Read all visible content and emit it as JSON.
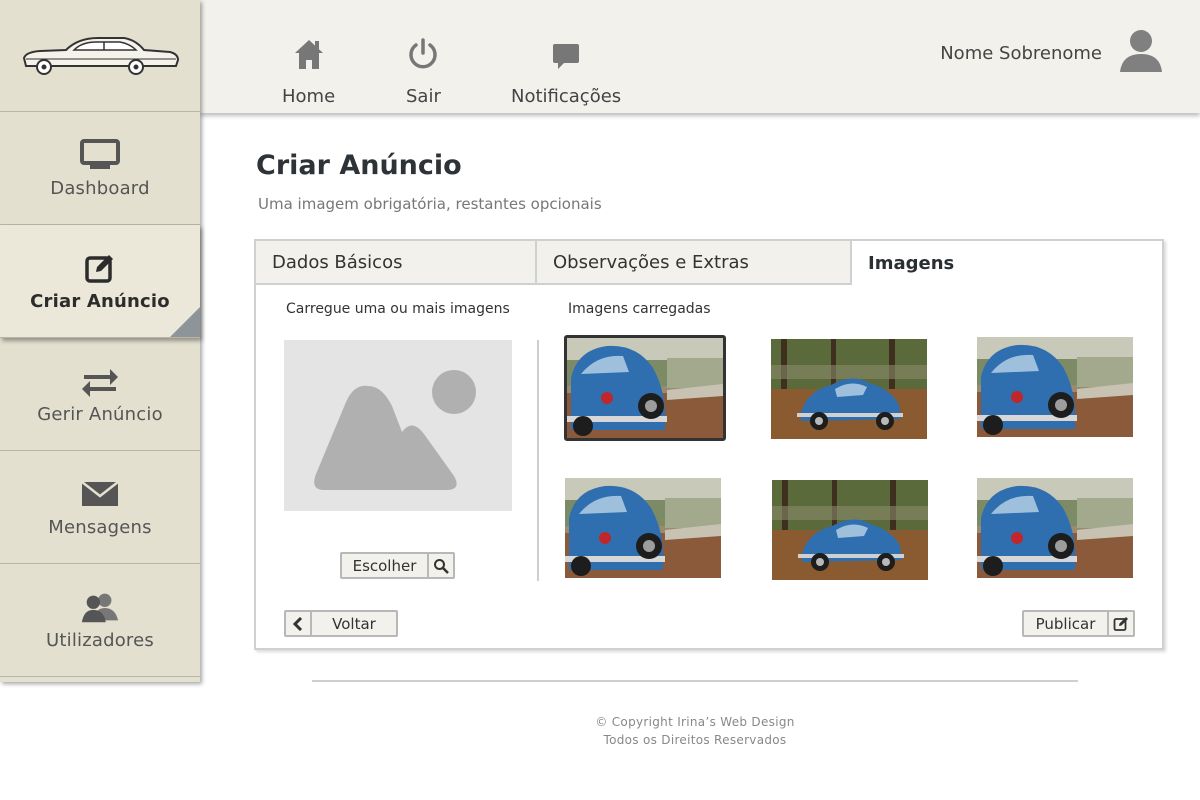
{
  "topbar": {
    "nav": [
      {
        "label": "Home",
        "icon": "home-icon"
      },
      {
        "label": "Sair",
        "icon": "power-icon"
      },
      {
        "label": "Notificações",
        "icon": "chat-icon"
      }
    ],
    "user_name": "Nome Sobrenome"
  },
  "sidebar": {
    "logo_icon": "car-logo-icon",
    "items": [
      {
        "label": "Dashboard",
        "icon": "monitor-icon"
      },
      {
        "label": "Criar Anúncio",
        "icon": "edit-icon",
        "active": true
      },
      {
        "label": "Gerir Anúncio",
        "icon": "exchange-icon"
      },
      {
        "label": "Mensagens",
        "icon": "envelope-icon"
      },
      {
        "label": "Utilizadores",
        "icon": "users-icon"
      }
    ]
  },
  "main": {
    "title": "Criar Anúncio",
    "subtitle": "Uma imagem obrigatória, restantes opcionais",
    "tabs": [
      {
        "label": "Dados Básicos"
      },
      {
        "label": "Observações e Extras"
      },
      {
        "label": "Imagens",
        "active": true
      }
    ],
    "upload_label": "Carregue uma ou mais imagens",
    "uploaded_label": "Imagens carregadas",
    "choose_button": "Escolher",
    "back_button": "Voltar",
    "publish_button": "Publicar",
    "thumbnails": [
      {
        "variant": "beetle-rear",
        "selected": true
      },
      {
        "variant": "beetle-park"
      },
      {
        "variant": "beetle-rear"
      },
      {
        "variant": "beetle-rear"
      },
      {
        "variant": "beetle-park"
      },
      {
        "variant": "beetle-rear"
      }
    ]
  },
  "footer": {
    "copyright": "© Copyright Irina’s Web Design",
    "rights": "Todos os Direitos Reservados"
  },
  "colors": {
    "sidebar_bg": "#e4e0d0",
    "topbar_bg": "#f3f1ec",
    "accent_dark": "#2e3338",
    "car_blue": "#2f6fb0"
  }
}
